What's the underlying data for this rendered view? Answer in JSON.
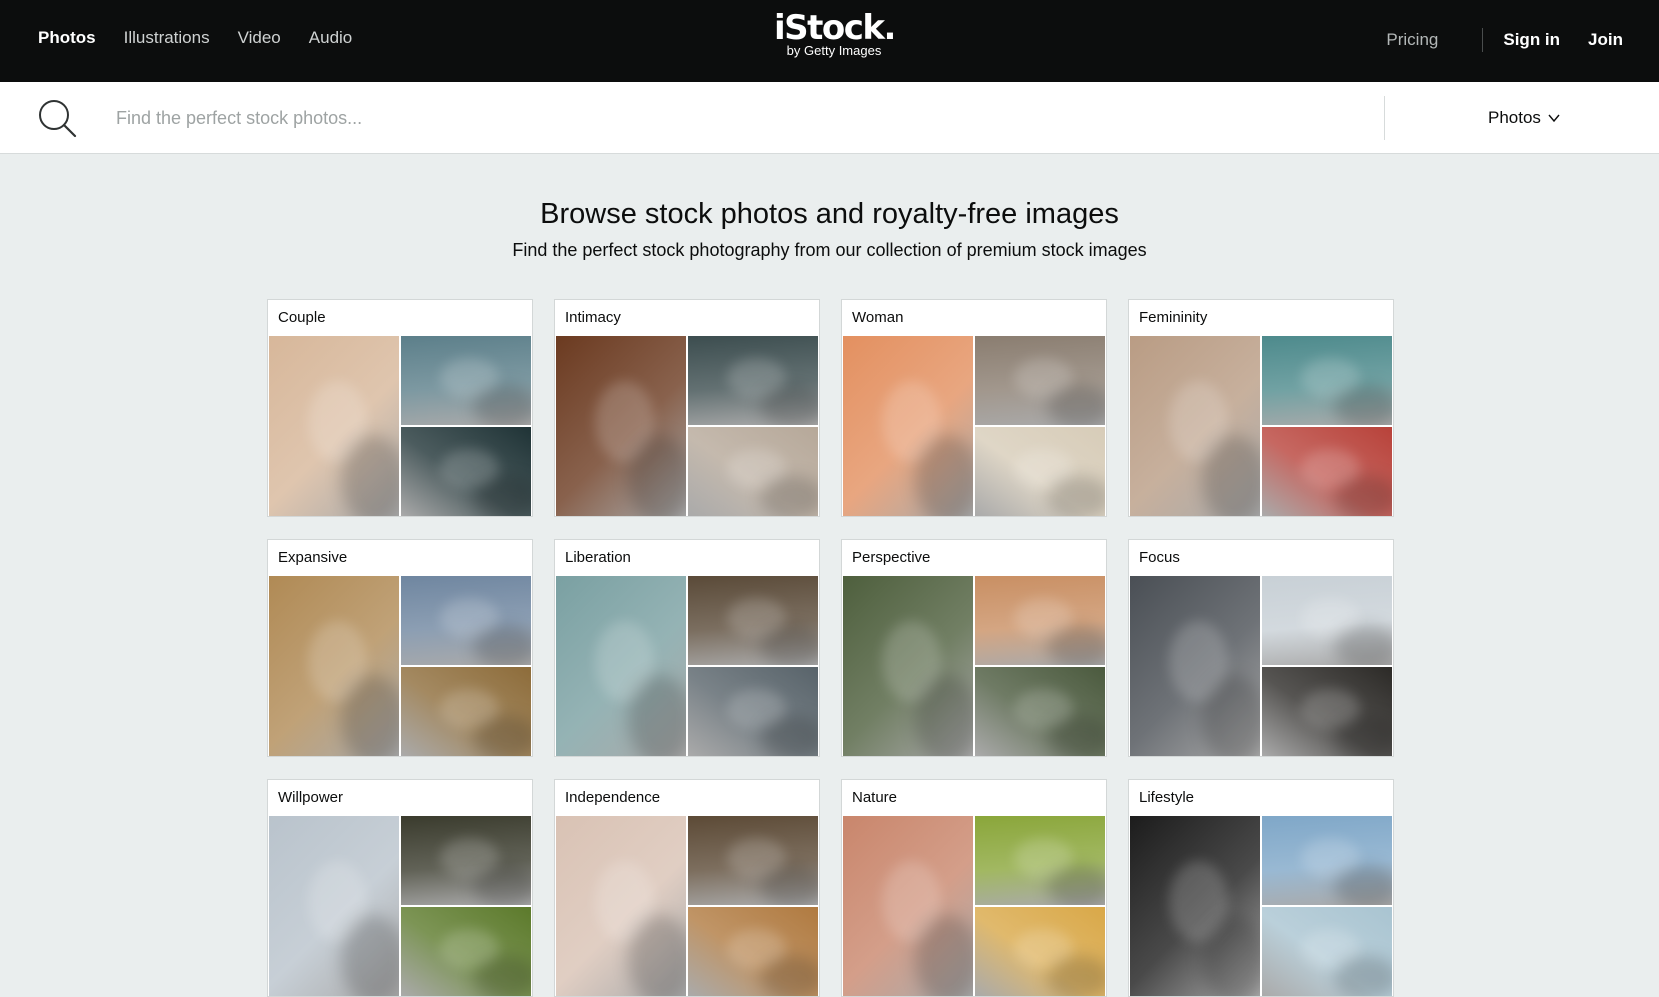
{
  "topbar": {
    "nav": [
      {
        "label": "Photos",
        "active": true
      },
      {
        "label": "Illustrations",
        "active": false
      },
      {
        "label": "Video",
        "active": false
      },
      {
        "label": "Audio",
        "active": false
      }
    ],
    "logo": {
      "brand": "iStock.",
      "sub": "by Getty Images"
    },
    "pricing": "Pricing",
    "signin": "Sign in",
    "join": "Join"
  },
  "search": {
    "placeholder": "Find the perfect stock photos...",
    "type": "Photos"
  },
  "hero": {
    "title": "Browse stock photos and royalty-free images",
    "subtitle": "Find the perfect stock photography from our collection of premium stock images"
  },
  "categories": [
    {
      "title": "Couple",
      "colors": [
        "#d7b79a",
        "#5c7f8a",
        "#1f3336"
      ]
    },
    {
      "title": "Intimacy",
      "colors": [
        "#6b3a20",
        "#3c4d4f",
        "#b6a899"
      ]
    },
    {
      "title": "Woman",
      "colors": [
        "#e39060",
        "#8a7d70",
        "#d7ccb8"
      ]
    },
    {
      "title": "Femininity",
      "colors": [
        "#b99c84",
        "#4d8a8c",
        "#b8423a"
      ]
    },
    {
      "title": "Expansive",
      "colors": [
        "#b08a55",
        "#6f86a0",
        "#8d6c3a"
      ]
    },
    {
      "title": "Liberation",
      "colors": [
        "#7aa0a2",
        "#5a4a38",
        "#58636a"
      ]
    },
    {
      "title": "Perspective",
      "colors": [
        "#4e5f3d",
        "#c98f63",
        "#4b5a3e"
      ]
    },
    {
      "title": "Focus",
      "colors": [
        "#4a4f55",
        "#c8d0d6",
        "#2c2a27"
      ]
    },
    {
      "title": "Willpower",
      "colors": [
        "#b9c3cc",
        "#3a3b2d",
        "#5c7a2b"
      ]
    },
    {
      "title": "Independence",
      "colors": [
        "#d9c2b4",
        "#5c4a36",
        "#b07a40"
      ]
    },
    {
      "title": "Nature",
      "colors": [
        "#c9866c",
        "#8aa63a",
        "#d9a848"
      ]
    },
    {
      "title": "Lifestyle",
      "colors": [
        "#1c1c1c",
        "#7fa7c8",
        "#a9c4d1"
      ]
    }
  ]
}
